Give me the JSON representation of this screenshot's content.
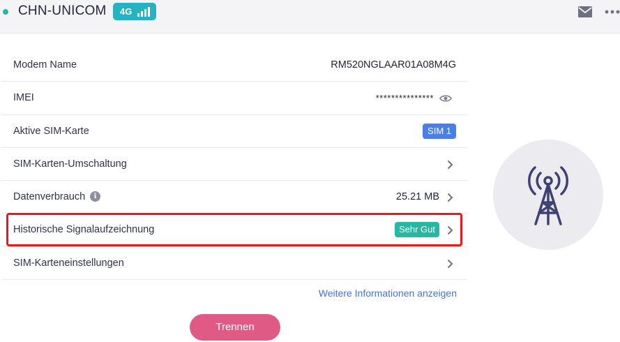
{
  "header": {
    "carrier": "CHN-UNICOM",
    "network_type": "4G",
    "icons": [
      "status-dot",
      "signal-bars-icon",
      "mail-icon",
      "more-icon"
    ],
    "colors": {
      "badge": "#25b3c4",
      "status_dot": "#2bb5a8"
    }
  },
  "device_info": {
    "modem_name": {
      "label": "Modem Name",
      "value": "RM520NGLAAR01A08M4G"
    },
    "imei": {
      "label": "IMEI",
      "value": "***************",
      "icon": "eye-icon"
    },
    "active_sim": {
      "label": "Aktive SIM-Karte",
      "value": "SIM 1"
    },
    "sim_switch": {
      "label": "SIM-Karten-Umschaltung"
    },
    "data_usage": {
      "label": "Datenverbrauch",
      "value": "25.21 MB",
      "info_icon": "i"
    },
    "signal_history": {
      "label": "Historische Signalaufzeichnung",
      "status": "Sehr Gut"
    },
    "sim_settings": {
      "label": "SIM-Karteneinstellungen"
    }
  },
  "more_info_link": "Weitere Informationen anzeigen",
  "disconnect_button": "Trennen",
  "colors": {
    "sim_badge": "#4b7fe8",
    "good_badge": "#23b9a3",
    "disconnect": "#df5b86",
    "link": "#4b70d6",
    "highlight": "#e8191b",
    "tower": "#3d4272"
  }
}
